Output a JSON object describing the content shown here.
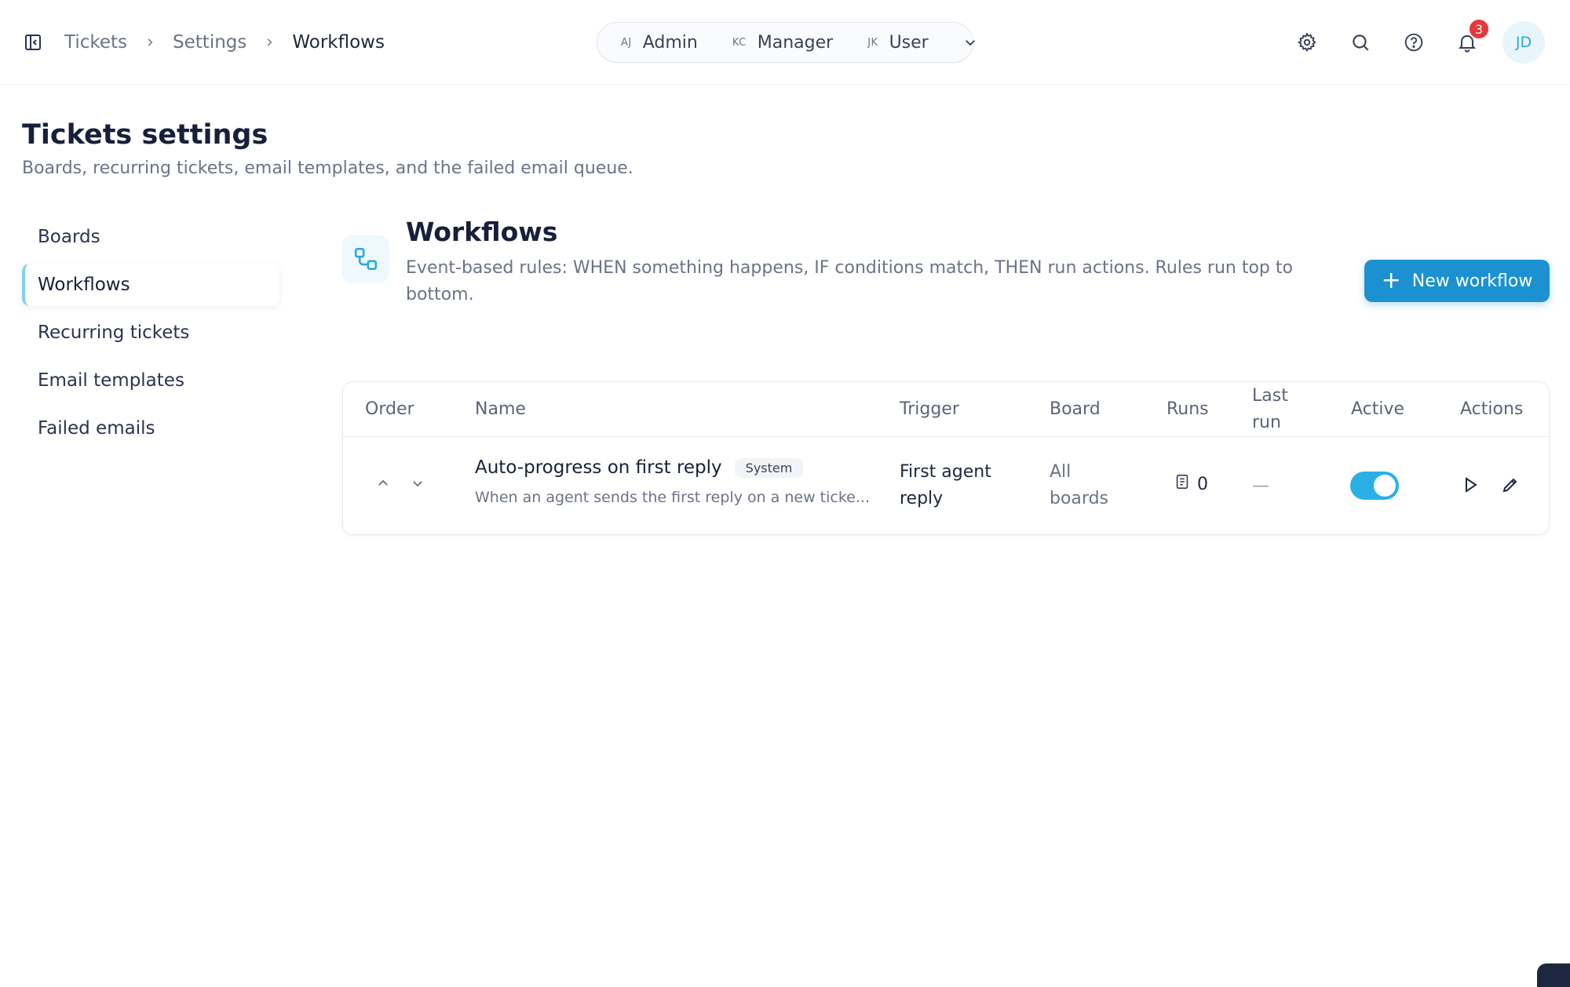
{
  "breadcrumb": {
    "items": [
      "Tickets",
      "Settings",
      "Workflows"
    ]
  },
  "roles": [
    {
      "initials": "AJ",
      "name": "Admin"
    },
    {
      "initials": "KC",
      "name": "Manager"
    },
    {
      "initials": "JK",
      "name": "User"
    }
  ],
  "header": {
    "notification_count": "3",
    "avatar_initials": "JD"
  },
  "page": {
    "title": "Tickets settings",
    "subtitle": "Boards, recurring tickets, email templates, and the failed email queue."
  },
  "nav": {
    "active": "Workflows",
    "items": [
      "Boards",
      "Workflows",
      "Recurring tickets",
      "Email templates",
      "Failed emails"
    ]
  },
  "section": {
    "title": "Workflows",
    "description": "Event-based rules: WHEN something happens, IF conditions match, THEN run actions. Rules run top to bottom.",
    "new_button": "New workflow"
  },
  "table": {
    "headers": {
      "order": "Order",
      "name": "Name",
      "trigger": "Trigger",
      "board": "Board",
      "runs": "Runs",
      "last_run": "Last run",
      "active": "Active",
      "actions": "Actions"
    },
    "rows": [
      {
        "name": "Auto-progress on first reply",
        "badge": "System",
        "description": "When an agent sends the first reply on a new ticke...",
        "trigger": "First agent reply",
        "board": "All boards",
        "runs": "0",
        "last_run": "—",
        "active": true
      }
    ]
  },
  "colors": {
    "accent": "#1c91d2",
    "toggle_on": "#2bb0e6",
    "badge": "#e5383b",
    "active_nav_bar": "#7fd0f0"
  },
  "icons": [
    "sidebar-toggle-icon",
    "chevron-right-icon",
    "chevron-down-icon",
    "gear-icon",
    "search-icon",
    "help-icon",
    "bell-icon",
    "workflow-icon",
    "plus-icon",
    "chevron-up-icon",
    "runs-icon",
    "play-icon",
    "pencil-icon"
  ]
}
